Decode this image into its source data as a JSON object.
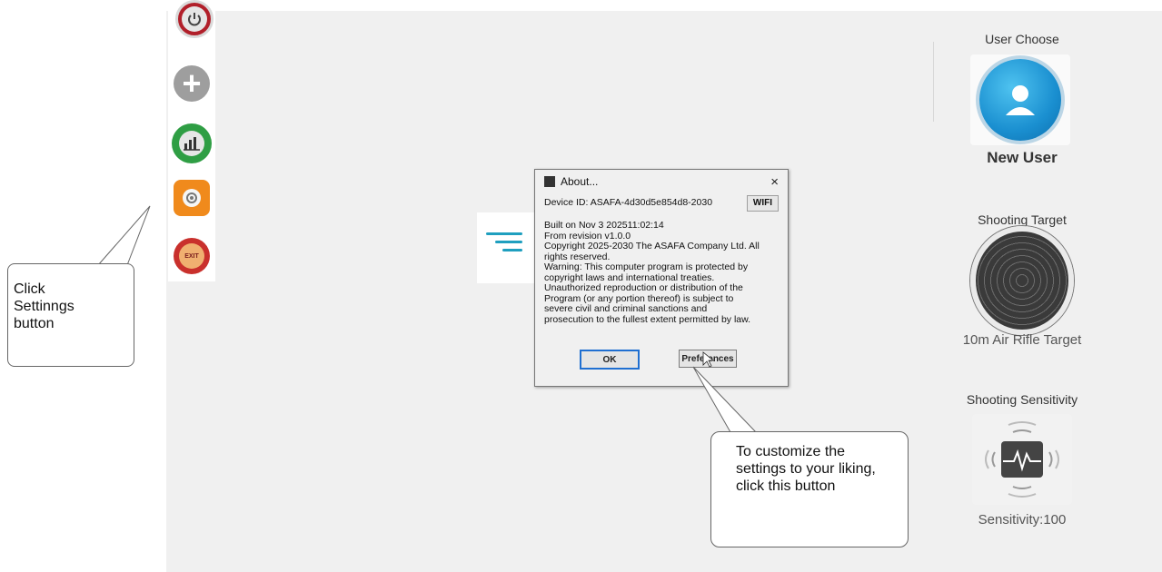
{
  "toolbar": {
    "reset_text": "RESET",
    "analysis_text": "DATA ANALYSIS",
    "exit_text": "EXIT"
  },
  "right_panel": {
    "user_choose_label": "User Choose",
    "user_name": "New User",
    "shooting_target_label": "Shooting Target",
    "target_name": "10m Air Rifle Target",
    "sensitivity_label": "Shooting Sensitivity",
    "sensitivity_value": "Sensitivity:100"
  },
  "dialog": {
    "title": "About...",
    "close": "×",
    "device_id": "Device ID:  ASAFA-4d30d5e854d8-2030",
    "wifi_label": "WIFI",
    "lines": [
      "Built on Nov  3 202511:02:14",
      "From revision v1.0.0",
      "Copyright 2025-2030 The ASAFA Company Ltd. All",
      "rights reserved.",
      "Warning: This computer program is protected by",
      "copyright laws and international treaties.",
      "Unauthorized reproduction or distribution of the",
      "Program (or any portion thereof) is subject to",
      "severe civil and criminal sanctions and",
      "prosecution to the fullest extent permitted by law."
    ],
    "ok_label": "OK",
    "preferences_label": "Preferences"
  },
  "callouts": {
    "settings_hint": "Click Settinngs button",
    "preferences_hint": "To customize the settings to your liking, click this button"
  },
  "colors": {
    "accent": "#1f9fbf",
    "settings_orange": "#f08a1c",
    "reset_red": "#b11f2a",
    "analysis_green": "#2f9e44"
  }
}
